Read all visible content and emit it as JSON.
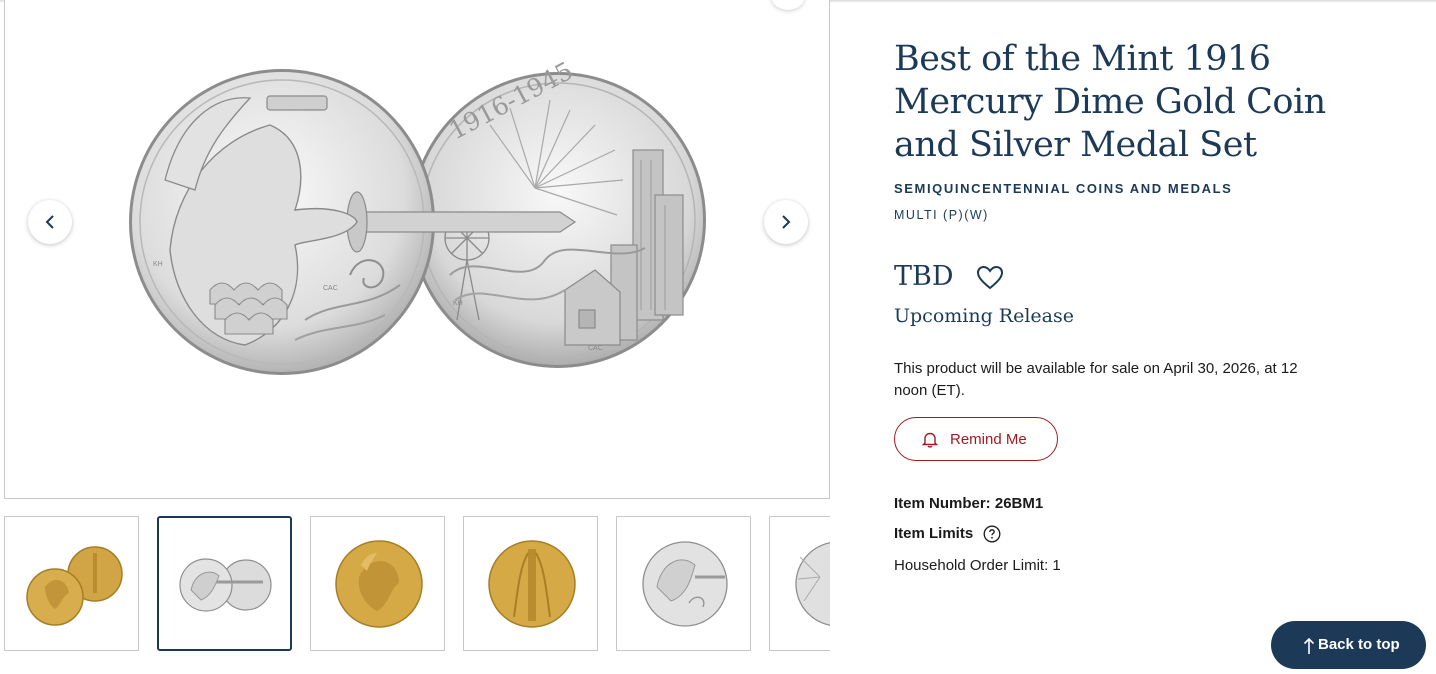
{
  "gallery": {
    "main_image_alt": "",
    "main_coin_left_initials": [
      "KH",
      "CAC"
    ],
    "main_coin_right_legend": "1916-1945",
    "main_coin_right_initials": [
      "KH",
      "CAC"
    ],
    "prev_icon": "chevron-left-icon",
    "next_icon": "chevron-right-icon",
    "thumbnails": [
      {
        "kind": "gold-pair"
      },
      {
        "kind": "silver-pair",
        "active": true
      },
      {
        "kind": "gold-obverse"
      },
      {
        "kind": "gold-reverse"
      },
      {
        "kind": "silver-obverse"
      },
      {
        "kind": "silver-reverse-partial"
      }
    ]
  },
  "product": {
    "title": "Best of the Mint 1916 Mercury Dime Gold Coin and Silver Medal Set",
    "category": "SEMIQUINCENTENNIAL COINS AND MEDALS",
    "mint_mark": "MULTI (P)(W)",
    "price": "TBD",
    "favorite_icon": "heart-icon",
    "release_status": "Upcoming Release",
    "availability": "This product will be available for sale on April 30, 2026, at 12 noon (ET).",
    "remind_label": "Remind Me",
    "item_number": "Item Number: 26BM1",
    "item_limits_label": "Item Limits",
    "household_limit": "Household Order Limit: 1"
  },
  "back_to_top": {
    "label": "Back to top"
  },
  "colors": {
    "navy": "#1c3a57",
    "accent_red": "#9b1c1f",
    "gold": "#d1a545",
    "silver": "#d4d4d4"
  }
}
